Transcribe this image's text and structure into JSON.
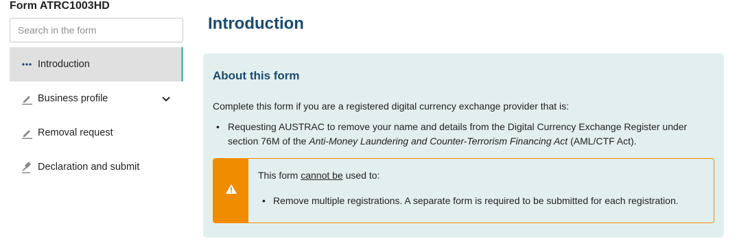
{
  "sidebar": {
    "form_title": "Form ATRC1003HD",
    "search_placeholder": "Search in the form",
    "items": [
      {
        "label": "Introduction",
        "icon": "ellipsis-icon",
        "active": true
      },
      {
        "label": "Business profile",
        "icon": "pencil-icon",
        "expandable": true
      },
      {
        "label": "Removal request",
        "icon": "pencil-icon"
      },
      {
        "label": "Declaration and submit",
        "icon": "gavel-icon"
      }
    ],
    "active_marker_color": "#5bbfb0"
  },
  "main": {
    "page_title": "Introduction",
    "panel": {
      "heading": "About this form",
      "intro": "Complete this form if you are a registered digital currency exchange provider that is:",
      "bullet_part1": "Requesting AUSTRAC to remove your name and details from the Digital Currency Exchange Register under section 76M of the ",
      "bullet_act": "Anti-Money Laundering and Counter-Terrorism Financing Act",
      "bullet_part2": " (AML/CTF Act).",
      "warning": {
        "prefix": "This form ",
        "underlined": "cannot be",
        "suffix": " used to:",
        "item": "Remove multiple registrations. A separate form is required to be submitted for each registration.",
        "accent_color": "#f08c00",
        "icon": "warning-icon"
      }
    }
  }
}
